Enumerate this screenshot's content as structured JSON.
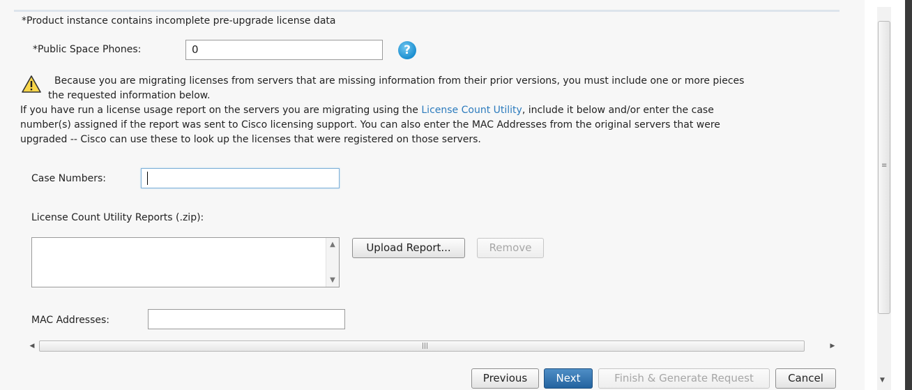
{
  "header_note": "*Product instance contains incomplete pre-upgrade license data",
  "public_space_phones": {
    "label": "*Public Space Phones:",
    "value": "0",
    "help_icon": "?"
  },
  "warning": {
    "line1": "Because you are migrating licenses from servers that are missing information from their prior versions, you must include one or more pieces",
    "line2": "the requested information below."
  },
  "instructions": {
    "line1_before_link": "If you have run a license usage report on the servers you are migrating using the ",
    "link_text": "License Count Utility",
    "line1_after_link": ", include it below and/or enter the case",
    "line2": "number(s) assigned if the report was sent to Cisco licensing support. You can also enter the MAC Addresses from the original servers that were",
    "line3": "upgraded -- Cisco can use these to look up the licenses that were registered on those servers."
  },
  "case_numbers": {
    "label": "Case Numbers:",
    "value": ""
  },
  "reports": {
    "label": "License Count Utility Reports (.zip):",
    "upload_label": "Upload Report...",
    "remove_label": "Remove"
  },
  "mac_addresses": {
    "label": "MAC Addresses:",
    "value": ""
  },
  "footer": {
    "previous_label": "Previous",
    "next_label": "Next",
    "finish_label": "Finish & Generate Request",
    "cancel_label": "Cancel"
  },
  "colors": {
    "link": "#2c7bbd",
    "primary_button": "#23639f",
    "focus_border": "#7fb0d8"
  },
  "icons": [
    "help-icon",
    "warning-icon",
    "scroll-up-icon",
    "scroll-down-icon",
    "scroll-left-icon",
    "scroll-right-icon"
  ]
}
